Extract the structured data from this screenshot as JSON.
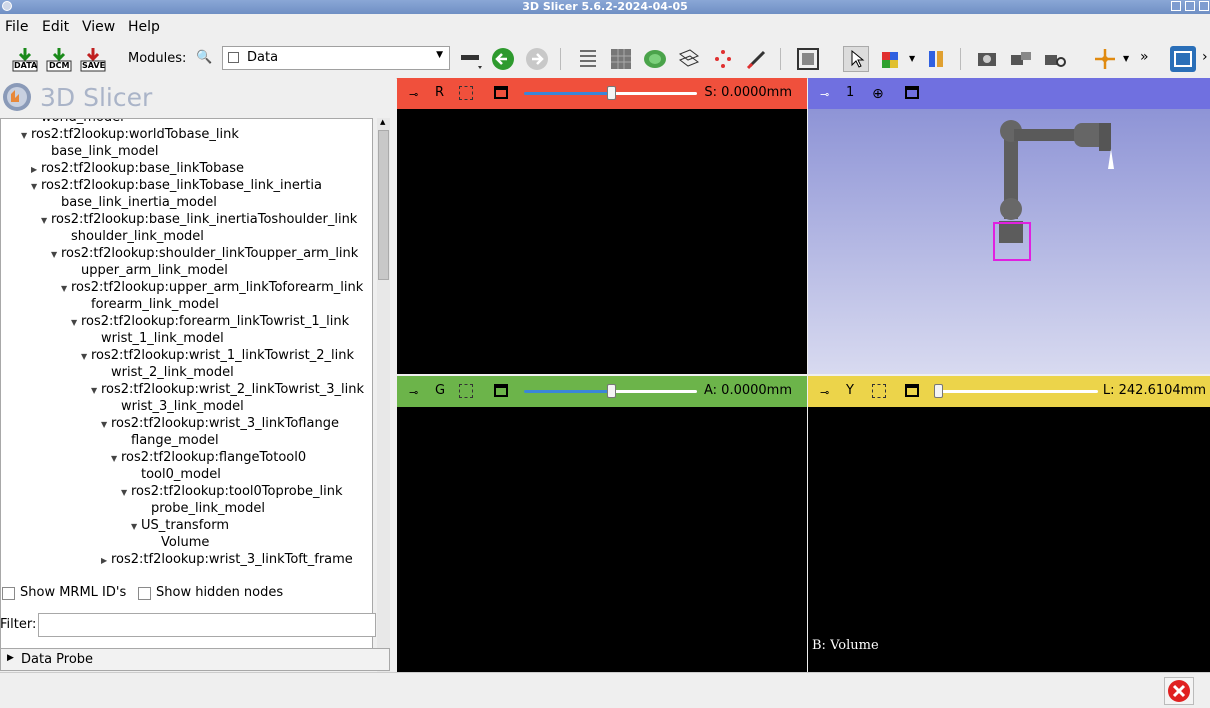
{
  "window": {
    "title": "3D Slicer 5.6.2-2024-04-05"
  },
  "menu": {
    "file": "File",
    "edit": "Edit",
    "view": "View",
    "help": "Help"
  },
  "toolbar": {
    "data_label": "DATA",
    "dcm_label": "DCM",
    "save_label": "SAVE",
    "modules_label": "Modules:",
    "module_selected": "Data"
  },
  "logo": {
    "text": "3D Slicer"
  },
  "tree": {
    "rows": [
      {
        "label": "world_model"
      },
      {
        "label": "ros2:tf2lookup:worldTobase_link"
      },
      {
        "label": "base_link_model"
      },
      {
        "label": "ros2:tf2lookup:base_linkTobase"
      },
      {
        "label": "ros2:tf2lookup:base_linkTobase_link_inertia"
      },
      {
        "label": "base_link_inertia_model"
      },
      {
        "label": "ros2:tf2lookup:base_link_inertiaToshoulder_link"
      },
      {
        "label": "shoulder_link_model"
      },
      {
        "label": "ros2:tf2lookup:shoulder_linkToupper_arm_link"
      },
      {
        "label": "upper_arm_link_model"
      },
      {
        "label": "ros2:tf2lookup:upper_arm_linkToforearm_link"
      },
      {
        "label": "forearm_link_model"
      },
      {
        "label": "ros2:tf2lookup:forearm_linkTowrist_1_link"
      },
      {
        "label": "wrist_1_link_model"
      },
      {
        "label": "ros2:tf2lookup:wrist_1_linkTowrist_2_link"
      },
      {
        "label": "wrist_2_link_model"
      },
      {
        "label": "ros2:tf2lookup:wrist_2_linkTowrist_3_link"
      },
      {
        "label": "wrist_3_link_model"
      },
      {
        "label": "ros2:tf2lookup:wrist_3_linkToflange"
      },
      {
        "label": "flange_model"
      },
      {
        "label": "ros2:tf2lookup:flangeTotool0"
      },
      {
        "label": "tool0_model"
      },
      {
        "label": "ros2:tf2lookup:tool0Toprobe_link"
      },
      {
        "label": "probe_link_model"
      },
      {
        "label": "US_transform"
      },
      {
        "label": "Volume"
      },
      {
        "label": "ros2:tf2lookup:wrist_3_linkToft_frame"
      }
    ]
  },
  "options": {
    "show_mrml_ids": "Show MRML ID's",
    "show_hidden_nodes": "Show hidden nodes"
  },
  "filter": {
    "label": "Filter:",
    "value": ""
  },
  "data_probe": {
    "label": "Data Probe"
  },
  "views": {
    "red": {
      "letter": "R",
      "offset": "S: 0.0000mm",
      "color": "#f0503c",
      "slider": 0.5
    },
    "three_d": {
      "letter": "1",
      "color": "#7070e0"
    },
    "green": {
      "letter": "G",
      "offset": "A: 0.0000mm",
      "color": "#6cb44a",
      "slider": 0.5
    },
    "yellow": {
      "letter": "Y",
      "offset": "L: 242.6104mm",
      "color": "#ecd44a",
      "slider": 0.0
    },
    "yellow_overlay": "B: Volume"
  }
}
